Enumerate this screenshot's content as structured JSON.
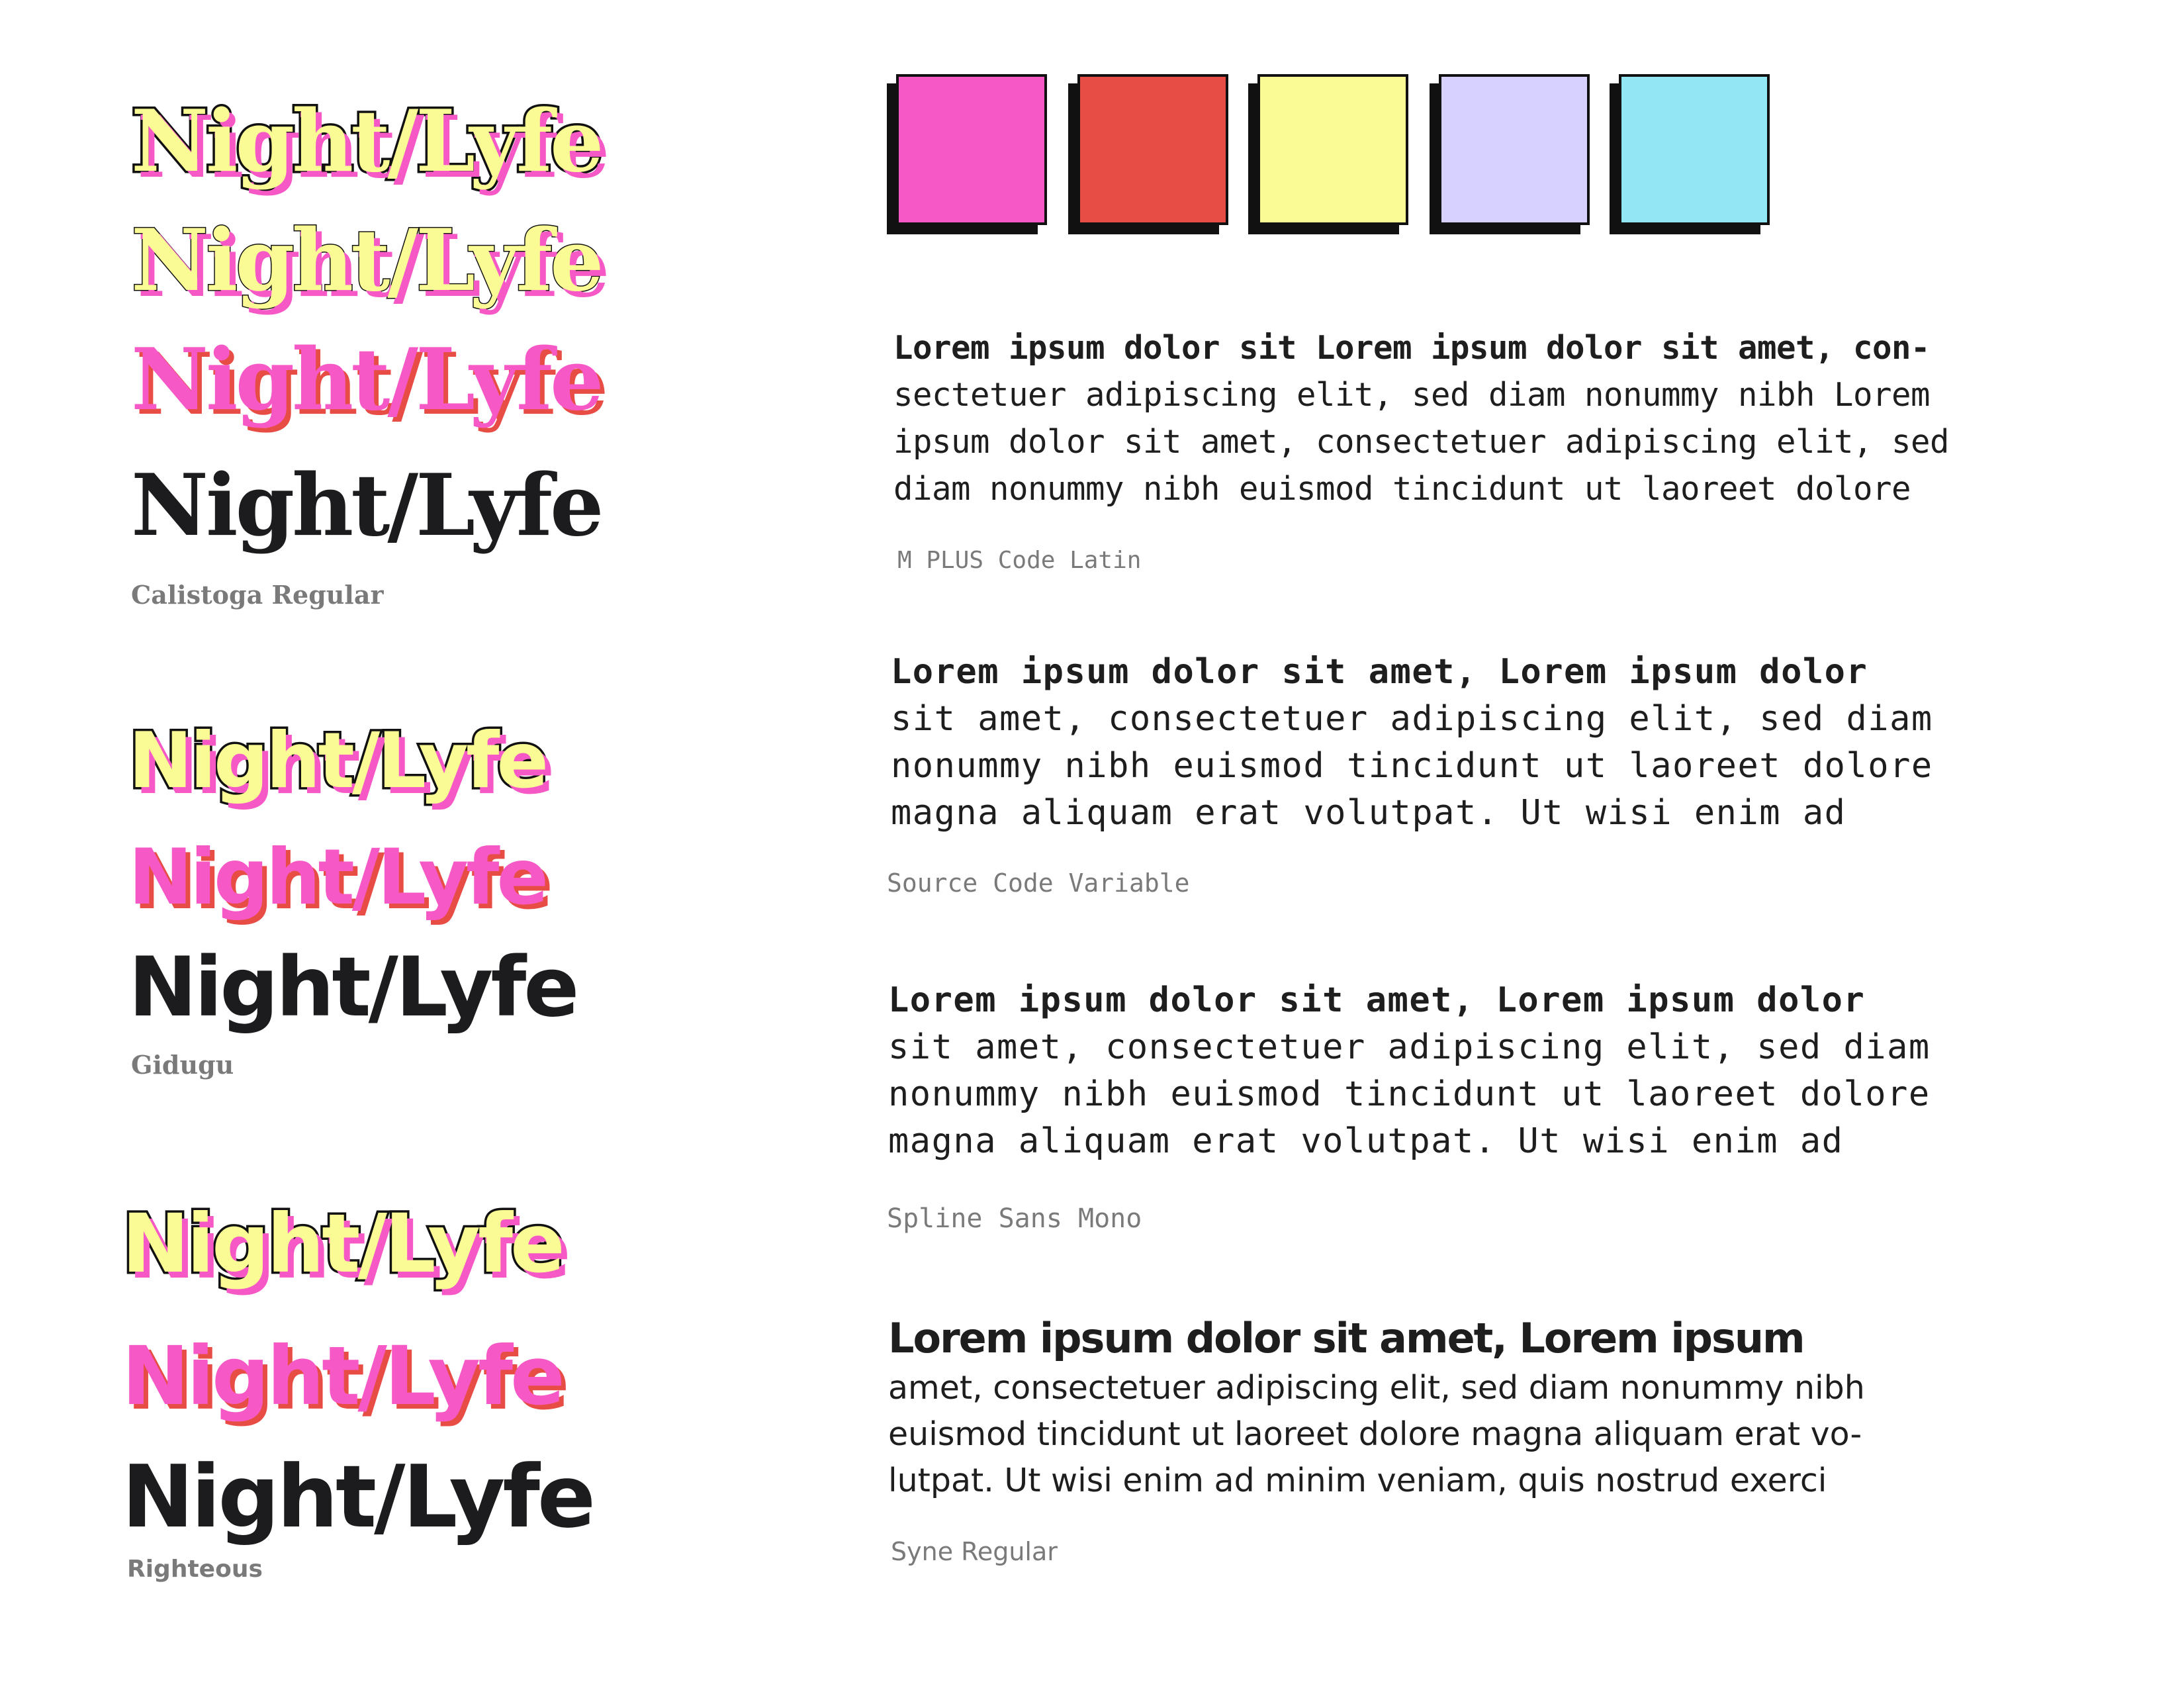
{
  "colors": {
    "yellow": "#fafb94",
    "pink": "#f659c6",
    "red": "#e84d45",
    "dark": "#1c1c1e",
    "gray": "#7a7a7a"
  },
  "palette": [
    {
      "name": "pink",
      "hex": "#f659c6"
    },
    {
      "name": "red",
      "hex": "#e84d45"
    },
    {
      "name": "yellow",
      "hex": "#fafb94"
    },
    {
      "name": "lavender",
      "hex": "#d6d1ff"
    },
    {
      "name": "cyan",
      "hex": "#93e6f3"
    }
  ],
  "wordmark": "Night/Lyfe",
  "display_fonts": [
    {
      "caption": "Calistoga Regular"
    },
    {
      "caption": "Gidugu"
    },
    {
      "caption": "Righteous"
    }
  ],
  "body_specimens": [
    {
      "lines": [
        "Lorem ipsum dolor sit Lorem ipsum dolor sit amet, con-",
        "sectetuer adipiscing elit, sed diam nonummy nibh Lorem",
        "ipsum dolor sit amet, consectetuer adipiscing elit, sed",
        "diam nonummy nibh euismod tincidunt ut laoreet dolore"
      ],
      "caption": "M PLUS Code Latin"
    },
    {
      "lines": [
        "Lorem ipsum dolor sit amet, Lorem ipsum dolor",
        "sit amet, consectetuer adipiscing elit, sed diam",
        "nonummy nibh euismod tincidunt ut laoreet dolore",
        "magna aliquam erat volutpat. Ut wisi enim ad"
      ],
      "caption": "Source Code Variable"
    },
    {
      "lines": [
        "Lorem ipsum dolor sit amet, Lorem ipsum dolor",
        "sit amet, consectetuer adipiscing elit, sed diam",
        "nonummy nibh euismod tincidunt ut laoreet dolore",
        "magna aliquam erat volutpat. Ut wisi enim ad"
      ],
      "caption": "Spline Sans Mono"
    },
    {
      "lines": [
        "Lorem ipsum dolor sit amet, Lorem ipsum",
        "amet, consectetuer adipiscing elit, sed diam nonummy nibh",
        "euismod tincidunt ut laoreet dolore magna aliquam erat vo-",
        "lutpat. Ut wisi enim ad minim veniam, quis nostrud exerci"
      ],
      "caption": "Syne Regular"
    }
  ]
}
